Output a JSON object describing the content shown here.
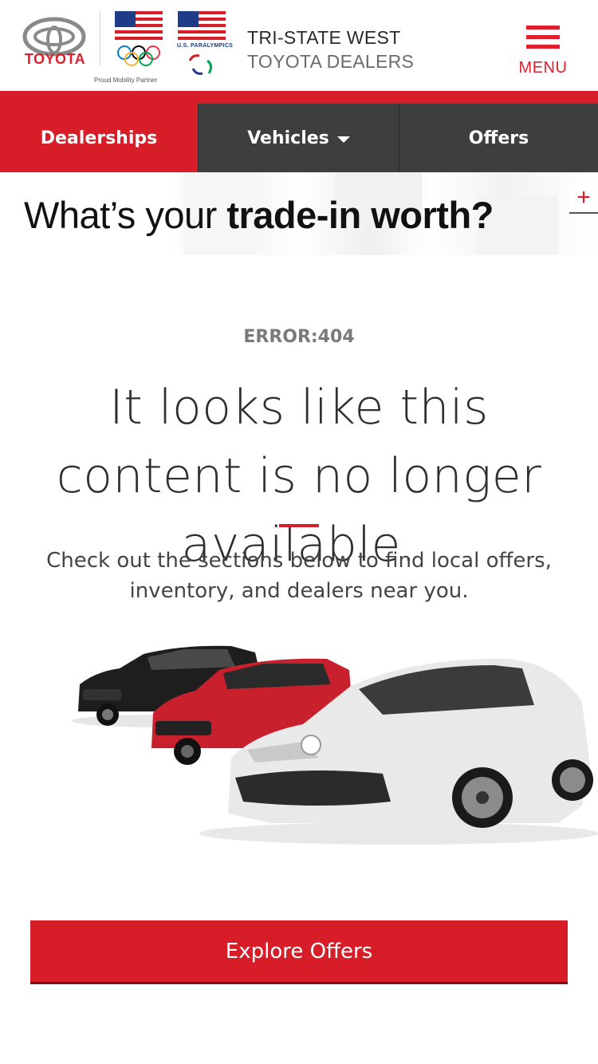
{
  "header": {
    "brand_word": "TOYOTA",
    "partner_text": "Proud Mobility Partner",
    "paralympics_text": "U.S. PARALYMPICS",
    "dealer_line1": "TRI-STATE WEST",
    "dealer_line2": "TOYOTA DEALERS",
    "menu_label": "MENU"
  },
  "nav": {
    "items": [
      {
        "label": "Dealerships"
      },
      {
        "label": "Vehicles"
      },
      {
        "label": "Offers"
      }
    ]
  },
  "banner": {
    "text_plain": "What’s your ",
    "text_bold": "trade-in worth?",
    "expand_symbol": "+"
  },
  "error": {
    "code": "ERROR:404",
    "heading": "It looks like this content is no longer available.",
    "subtext": "Check out the sections below to find local offers, inventory, and dealers near you."
  },
  "cta": {
    "label": "Explore Offers"
  },
  "colors": {
    "brand_red": "#d71e28",
    "nav_dark": "#3e3e3e"
  },
  "icons": {
    "menu": "hamburger-icon",
    "dropdown": "caret-down-icon",
    "expand": "plus-icon"
  }
}
